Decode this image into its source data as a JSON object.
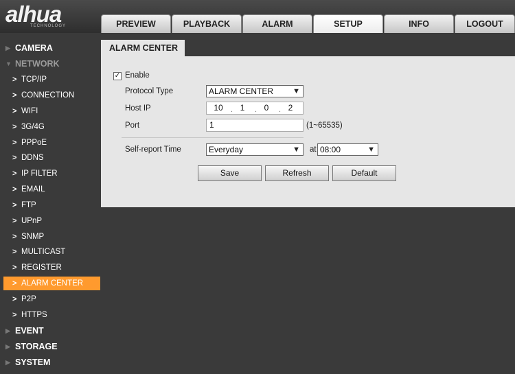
{
  "brand": {
    "logo_text": "alhua",
    "logo_sub": "TECHNOLOGY"
  },
  "tabs": [
    "PREVIEW",
    "PLAYBACK",
    "ALARM",
    "SETUP",
    "INFO",
    "LOGOUT"
  ],
  "sidebar": {
    "camera": "CAMERA",
    "network": "NETWORK",
    "items": [
      "TCP/IP",
      "CONNECTION",
      "WIFI",
      "3G/4G",
      "PPPoE",
      "DDNS",
      "IP FILTER",
      "EMAIL",
      "FTP",
      "UPnP",
      "SNMP",
      "MULTICAST",
      "REGISTER",
      "ALARM CENTER",
      "P2P",
      "HTTPS"
    ],
    "event": "EVENT",
    "storage": "STORAGE",
    "system": "SYSTEM",
    "active_item": "ALARM CENTER"
  },
  "panel": {
    "title": "ALARM CENTER",
    "enable_label": "Enable",
    "enable_mark": "✓",
    "protocol_label": "Protocol Type",
    "protocol_value": "ALARM CENTER",
    "host_label": "Host IP",
    "host_ip": [
      "10",
      "1",
      "0",
      "2"
    ],
    "port_label": "Port",
    "port_value": "1",
    "port_range": "(1~65535)",
    "self_report_label": "Self-report Time",
    "self_report_value": "Everyday",
    "at_label": "at",
    "time_value": "08:00",
    "buttons": {
      "save": "Save",
      "refresh": "Refresh",
      "default": "Default"
    }
  },
  "colors": {
    "accent": "#ff9a2e",
    "background": "#3a3a3a",
    "panel": "#e6e6e6"
  }
}
